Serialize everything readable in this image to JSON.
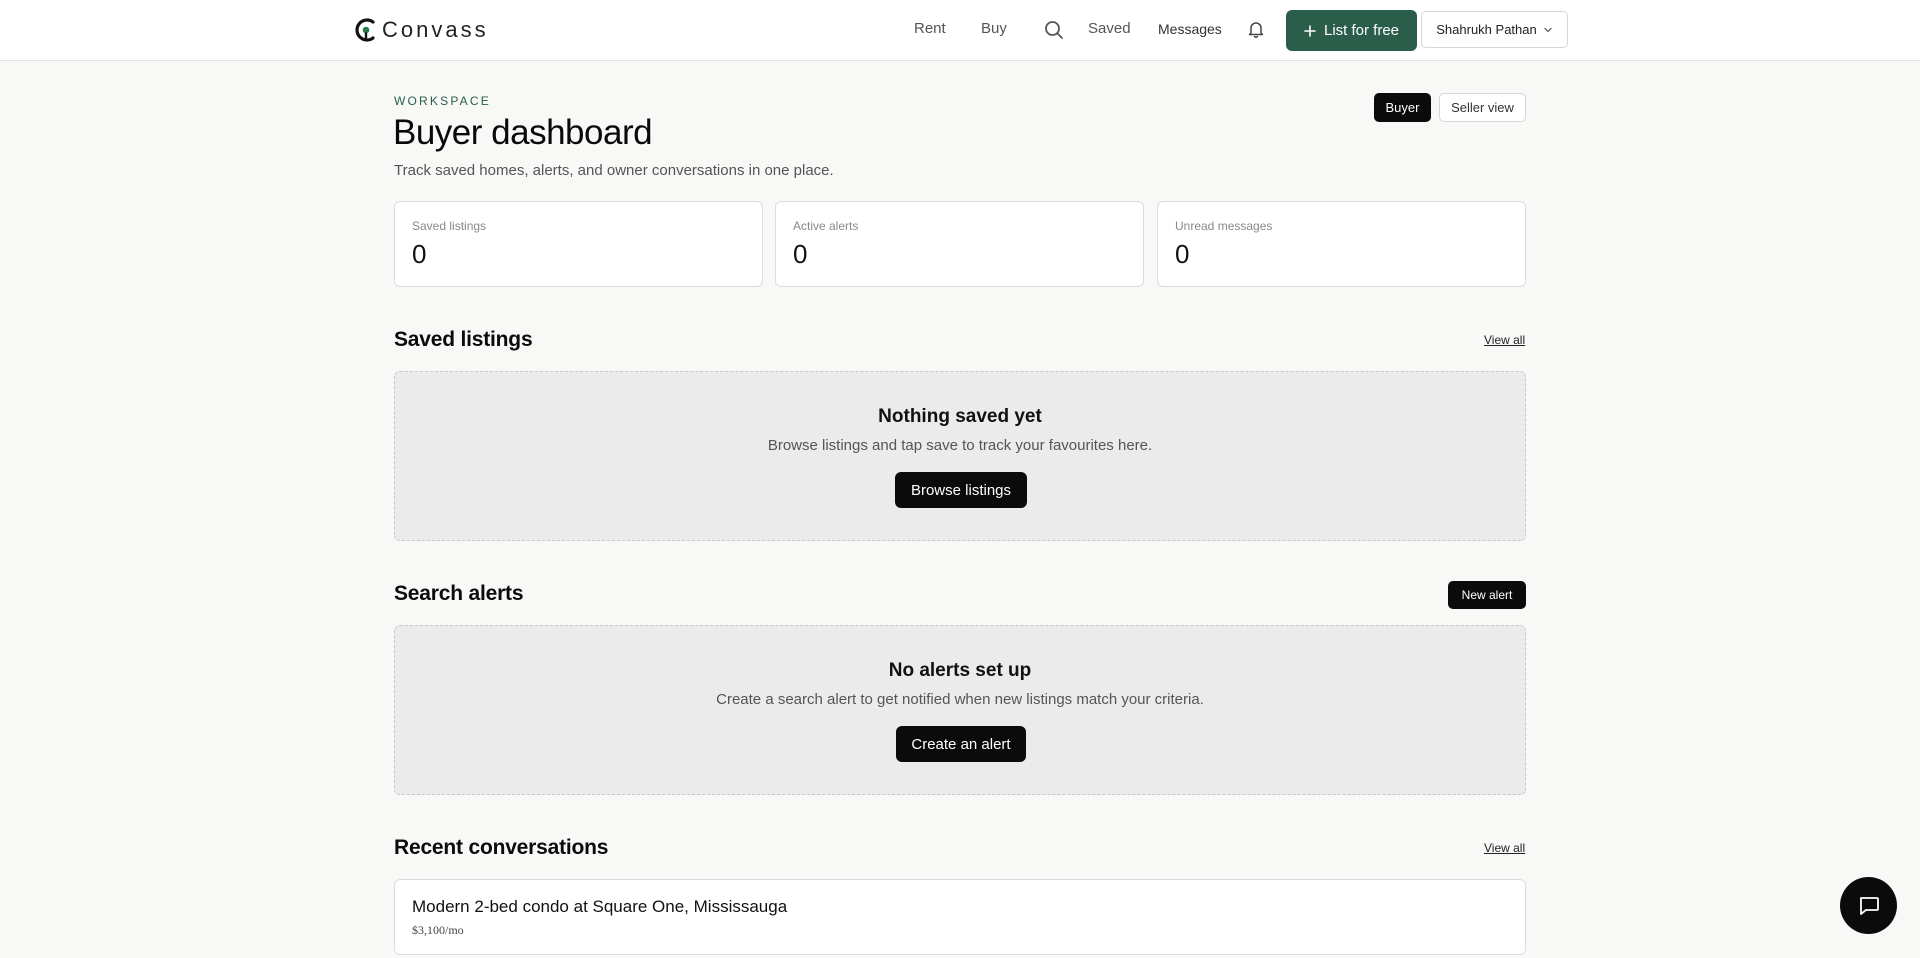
{
  "header": {
    "logo_text": "Convass",
    "nav": {
      "rent": "Rent",
      "buy": "Buy",
      "saved": "Saved",
      "messages": "Messages"
    },
    "list_button": "List for free",
    "user_name": "Shahrukh Pathan"
  },
  "page": {
    "eyebrow": "WORKSPACE",
    "title": "Buyer dashboard",
    "subtitle": "Track saved homes, alerts, and owner conversations in one place.",
    "view_toggle": {
      "buyer": "Buyer",
      "seller": "Seller view",
      "active": "Buyer"
    }
  },
  "stats": [
    {
      "label": "Saved listings",
      "value": "0"
    },
    {
      "label": "Active alerts",
      "value": "0"
    },
    {
      "label": "Unread messages",
      "value": "0"
    }
  ],
  "saved_listings": {
    "title": "Saved listings",
    "view_all": "View all",
    "empty_title": "Nothing saved yet",
    "empty_text": "Browse listings and tap save to track your favourites here.",
    "button": "Browse listings"
  },
  "search_alerts": {
    "title": "Search alerts",
    "new_alert": "New alert",
    "empty_title": "No alerts set up",
    "empty_text": "Create a search alert to get notified when new listings match your criteria.",
    "button": "Create an alert"
  },
  "conversations": {
    "title": "Recent conversations",
    "view_all": "View all",
    "items": [
      {
        "title": "Modern 2-bed condo at Square One, Mississauga",
        "price": "$3,100/mo"
      }
    ]
  },
  "colors": {
    "brand": "#2a5e4a",
    "dark": "#0b0b0b",
    "background": "#f8f8f7"
  }
}
